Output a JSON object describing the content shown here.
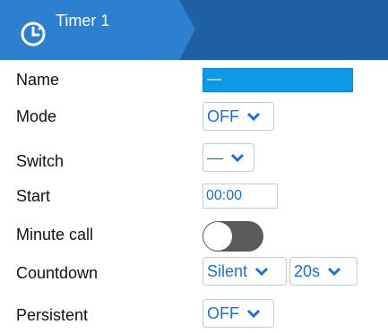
{
  "header": {
    "title": "Timer 1",
    "icon": "timer-icon"
  },
  "rows": {
    "name": {
      "label": "Name",
      "value": "—"
    },
    "mode": {
      "label": "Mode",
      "value": "OFF"
    },
    "switch": {
      "label": "Switch",
      "value": "—"
    },
    "start": {
      "label": "Start",
      "value": "00:00"
    },
    "minute_call": {
      "label": "Minute call",
      "enabled": false
    },
    "countdown": {
      "label": "Countdown",
      "value": "Silent",
      "duration": "20s"
    },
    "persistent": {
      "label": "Persistent",
      "value": "OFF"
    }
  },
  "colors": {
    "header_bg": "#1f5fa3",
    "header_tab": "#2d7fd0",
    "name_field_bg": "#0f98e6",
    "select_text": "#1d6fd1",
    "toggle_off": "#5a5a5a"
  }
}
